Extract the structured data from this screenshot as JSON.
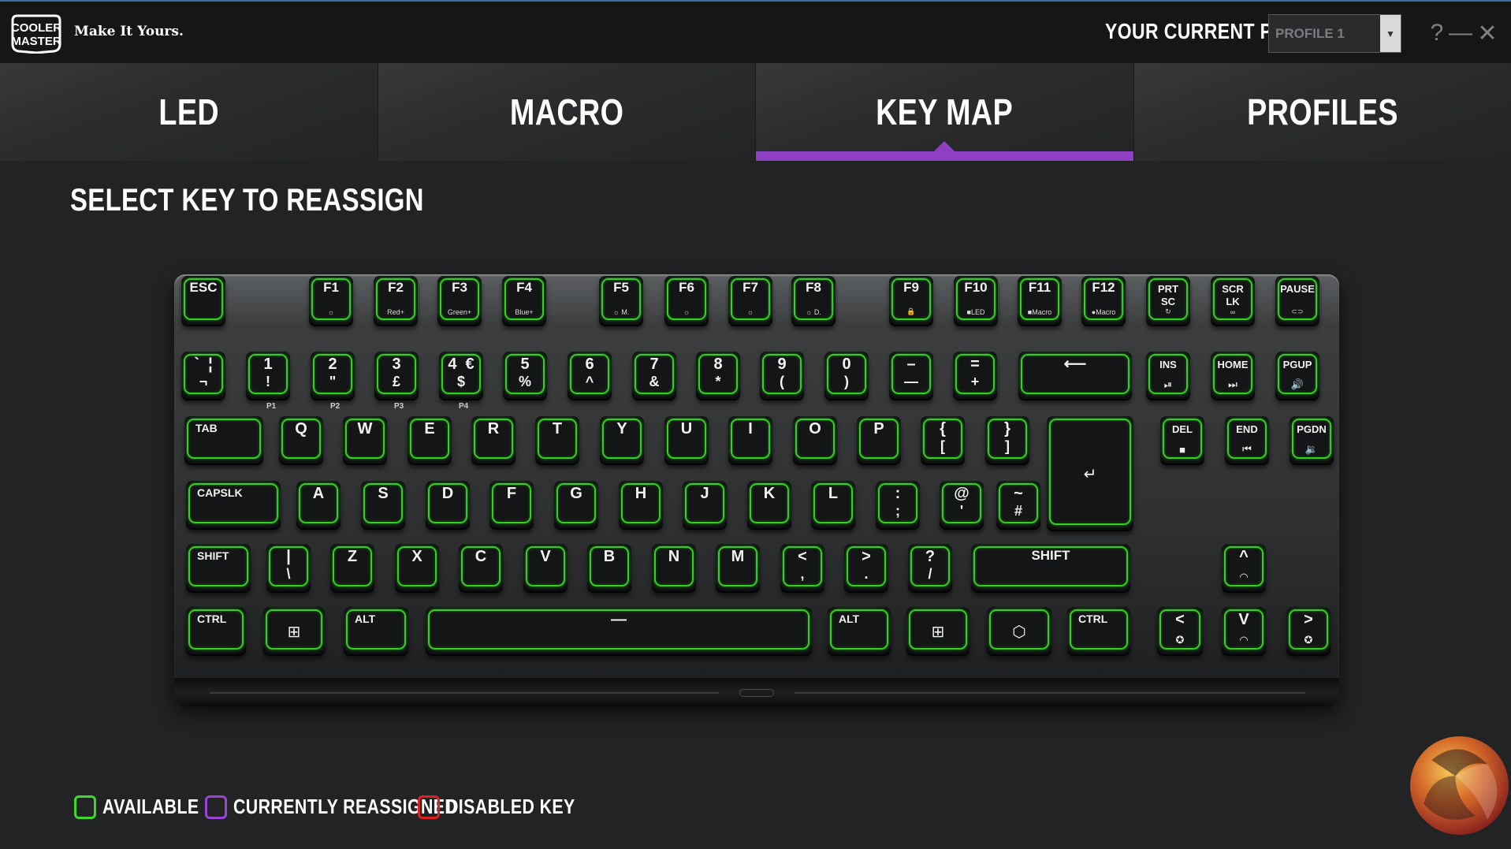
{
  "app": {
    "tagline": "Make It Yours.",
    "logo_text_1": "COOLER",
    "logo_text_2": "MASTER",
    "profile_label": "YOUR CURRENT PROFILE",
    "profile_value": "PROFILE 1",
    "help": "?",
    "minimize": "—",
    "close": "✕"
  },
  "tabs": [
    {
      "label": "LED",
      "active": false
    },
    {
      "label": "MACRO",
      "active": false
    },
    {
      "label": "KEY MAP",
      "active": true
    },
    {
      "label": "PROFILES",
      "active": false
    }
  ],
  "section_title": "SELECT KEY TO REASSIGN",
  "legend": [
    {
      "label": "AVAILABLE",
      "color": "#3fd92a"
    },
    {
      "label": "CURRENTLY REASSIGNED",
      "color": "#9a45d6"
    },
    {
      "label": "DISABLED KEY",
      "color": "#e01f1f"
    }
  ],
  "key_state_color": "#33d11f",
  "function_row": [
    {
      "id": "esc",
      "top": "ESC",
      "sub": ""
    },
    {
      "id": "f1",
      "top": "F1",
      "sub": "☼"
    },
    {
      "id": "f2",
      "top": "F2",
      "sub": "Red+"
    },
    {
      "id": "f3",
      "top": "F3",
      "sub": "Green+"
    },
    {
      "id": "f4",
      "top": "F4",
      "sub": "Blue+"
    },
    {
      "id": "f5",
      "top": "F5",
      "sub": "☼ M."
    },
    {
      "id": "f6",
      "top": "F6",
      "sub": "☼"
    },
    {
      "id": "f7",
      "top": "F7",
      "sub": "☼"
    },
    {
      "id": "f8",
      "top": "F8",
      "sub": "☼ D."
    },
    {
      "id": "f9",
      "top": "F9",
      "sub": "🔒"
    },
    {
      "id": "f10",
      "top": "F10",
      "sub": "■LED"
    },
    {
      "id": "f11",
      "top": "F11",
      "sub": "■Macro"
    },
    {
      "id": "f12",
      "top": "F12",
      "sub": "●Macro"
    },
    {
      "id": "prtsc",
      "top": "PRT\nSC",
      "sub": "↻"
    },
    {
      "id": "scrlk",
      "top": "SCR\nLK",
      "sub": "∞"
    },
    {
      "id": "pause",
      "top": "PAUSE",
      "sub": "⊂⊃"
    }
  ],
  "number_row": [
    {
      "id": "grave",
      "top": "`  ¦",
      "bottom": "¬"
    },
    {
      "id": "1",
      "top": "1",
      "bottom": "!"
    },
    {
      "id": "2",
      "top": "2",
      "bottom": "\""
    },
    {
      "id": "3",
      "top": "3",
      "bottom": "£"
    },
    {
      "id": "4",
      "top": "4  €",
      "bottom": "$"
    },
    {
      "id": "5",
      "top": "5",
      "bottom": "%"
    },
    {
      "id": "6",
      "top": "6",
      "bottom": "^"
    },
    {
      "id": "7",
      "top": "7",
      "bottom": "&"
    },
    {
      "id": "8",
      "top": "8",
      "bottom": "*"
    },
    {
      "id": "9",
      "top": "9",
      "bottom": "("
    },
    {
      "id": "0",
      "top": "0",
      "bottom": ")"
    },
    {
      "id": "minus",
      "top": "–",
      "bottom": "—"
    },
    {
      "id": "equal",
      "top": "=",
      "bottom": "+"
    },
    {
      "id": "backspace",
      "top": "⟵",
      "bottom": ""
    },
    {
      "id": "ins",
      "top": "INS",
      "bottom": "⏯"
    },
    {
      "id": "home",
      "top": "HOME",
      "bottom": "⏭"
    },
    {
      "id": "pgup",
      "top": "PGUP",
      "bottom": "🔊"
    }
  ],
  "profile_keys": [
    "P1",
    "P2",
    "P3",
    "P4"
  ],
  "tab_row": [
    {
      "id": "tab",
      "top": "TAB",
      "bottom": ""
    },
    {
      "id": "q",
      "top": "Q",
      "bottom": ""
    },
    {
      "id": "w",
      "top": "W",
      "bottom": ""
    },
    {
      "id": "e",
      "top": "E",
      "bottom": ""
    },
    {
      "id": "r",
      "top": "R",
      "bottom": ""
    },
    {
      "id": "t",
      "top": "T",
      "bottom": ""
    },
    {
      "id": "y",
      "top": "Y",
      "bottom": ""
    },
    {
      "id": "u",
      "top": "U",
      "bottom": ""
    },
    {
      "id": "i",
      "top": "I",
      "bottom": ""
    },
    {
      "id": "o",
      "top": "O",
      "bottom": ""
    },
    {
      "id": "p",
      "top": "P",
      "bottom": ""
    },
    {
      "id": "lbrace",
      "top": "{",
      "bottom": "["
    },
    {
      "id": "rbrace",
      "top": "}",
      "bottom": "]"
    },
    {
      "id": "enter",
      "top": "↵",
      "bottom": ""
    },
    {
      "id": "del",
      "top": "DEL",
      "bottom": "■"
    },
    {
      "id": "end",
      "top": "END",
      "bottom": "⏮"
    },
    {
      "id": "pgdn",
      "top": "PGDN",
      "bottom": "🔉"
    }
  ],
  "caps_row": [
    {
      "id": "capslk",
      "top": "CAPSLK",
      "bottom": ""
    },
    {
      "id": "a",
      "top": "A",
      "bottom": ""
    },
    {
      "id": "s",
      "top": "S",
      "bottom": ""
    },
    {
      "id": "d",
      "top": "D",
      "bottom": ""
    },
    {
      "id": "f",
      "top": "F",
      "bottom": ""
    },
    {
      "id": "g",
      "top": "G",
      "bottom": ""
    },
    {
      "id": "h",
      "top": "H",
      "bottom": ""
    },
    {
      "id": "j",
      "top": "J",
      "bottom": ""
    },
    {
      "id": "k",
      "top": "K",
      "bottom": ""
    },
    {
      "id": "l",
      "top": "L",
      "bottom": ""
    },
    {
      "id": "semicolon",
      "top": ":",
      "bottom": ";"
    },
    {
      "id": "quote",
      "top": "@",
      "bottom": "'"
    },
    {
      "id": "hash",
      "top": "~",
      "bottom": "#"
    }
  ],
  "shift_row": [
    {
      "id": "lshift",
      "top": "SHIFT",
      "bottom": ""
    },
    {
      "id": "backslash",
      "top": "|",
      "bottom": "\\"
    },
    {
      "id": "z",
      "top": "Z",
      "bottom": ""
    },
    {
      "id": "x",
      "top": "X",
      "bottom": ""
    },
    {
      "id": "c",
      "top": "C",
      "bottom": ""
    },
    {
      "id": "v",
      "top": "V",
      "bottom": ""
    },
    {
      "id": "b",
      "top": "B",
      "bottom": ""
    },
    {
      "id": "n",
      "top": "N",
      "bottom": ""
    },
    {
      "id": "m",
      "top": "M",
      "bottom": ""
    },
    {
      "id": "comma",
      "top": "<",
      "bottom": ","
    },
    {
      "id": "period",
      "top": ">",
      "bottom": "."
    },
    {
      "id": "slash",
      "top": "?",
      "bottom": "/"
    },
    {
      "id": "rshift",
      "top": "SHIFT",
      "bottom": ""
    },
    {
      "id": "up",
      "top": "^",
      "bottom": "◠"
    }
  ],
  "bottom_row": [
    {
      "id": "lctrl",
      "top": "CTRL",
      "bottom": ""
    },
    {
      "id": "lwin",
      "top": "⊞",
      "bottom": ""
    },
    {
      "id": "lalt",
      "top": "ALT",
      "bottom": ""
    },
    {
      "id": "space",
      "top": "—",
      "bottom": ""
    },
    {
      "id": "ralt",
      "top": "ALT",
      "bottom": ""
    },
    {
      "id": "rwin",
      "top": "⊞",
      "bottom": ""
    },
    {
      "id": "fn",
      "top": "⬡",
      "bottom": ""
    },
    {
      "id": "rctrl",
      "top": "CTRL",
      "bottom": ""
    },
    {
      "id": "left",
      "top": "<",
      "bottom": "✪"
    },
    {
      "id": "down",
      "top": "V",
      "bottom": "◠"
    },
    {
      "id": "right",
      "top": ">",
      "bottom": "✪"
    }
  ]
}
